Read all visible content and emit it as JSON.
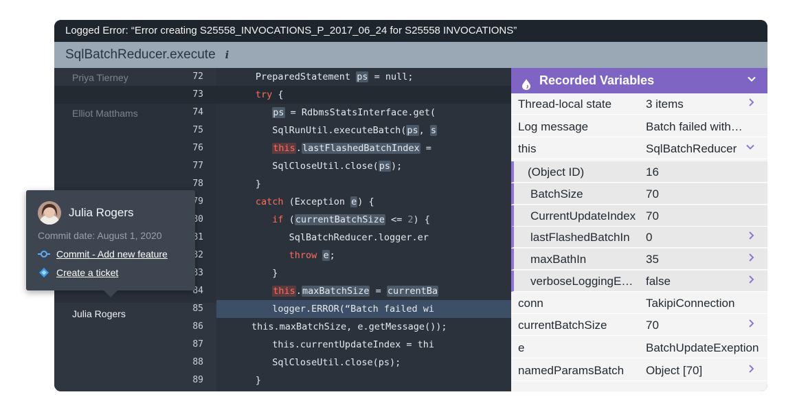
{
  "window": {
    "title": "Logged Error: “Error creating S25558_INVOCATIONS_P_2017_06_24 for S25558 INVOCATIONS”",
    "method": "SqlBatchReducer.execute",
    "info_glyph": "i"
  },
  "blame": {
    "names": [
      "Priya Tierney",
      "Elliot Matthams",
      "Julia Rogers"
    ]
  },
  "code": {
    "line_numbers": [
      "72",
      "73",
      "74",
      "75",
      "76",
      "77",
      "78",
      "79",
      "80",
      "81",
      "82",
      "83",
      "84",
      "85",
      "86",
      "87",
      "88",
      "89"
    ]
  },
  "popup": {
    "author": "Julia Rogers",
    "commit_date": "Commit date: August 1, 2020",
    "commit_link": "Commit - Add new feature",
    "ticket_link": "Create a ticket"
  },
  "variables": {
    "title": "Recorded Variables",
    "rows": [
      {
        "key": "Thread-local state",
        "value": "3 items"
      },
      {
        "key": "Log message",
        "value": "Batch failed with…"
      },
      {
        "key": "this",
        "value": "SqlBatchReducer"
      },
      {
        "key": "(Object ID)",
        "value": "16"
      },
      {
        "key": "BatchSize",
        "value": "70"
      },
      {
        "key": "CurrentUpdateIndex",
        "value": "70"
      },
      {
        "key": "lastFlashedBatchIn",
        "value": "0"
      },
      {
        "key": "maxBathIn",
        "value": "35"
      },
      {
        "key": "verboseLoggingEn…",
        "value": "false"
      },
      {
        "key": "conn",
        "value": "TakipiConnection"
      },
      {
        "key": "currentBatchSize",
        "value": "70"
      },
      {
        "key": "e",
        "value": "BatchUpdateExeption"
      },
      {
        "key": "namedParamsBatch",
        "value": "Object [70]"
      }
    ]
  },
  "colors": {
    "accent": "#7e65c4",
    "keyword": "#ff6c5b",
    "highlight_line": "#3d4f66"
  }
}
